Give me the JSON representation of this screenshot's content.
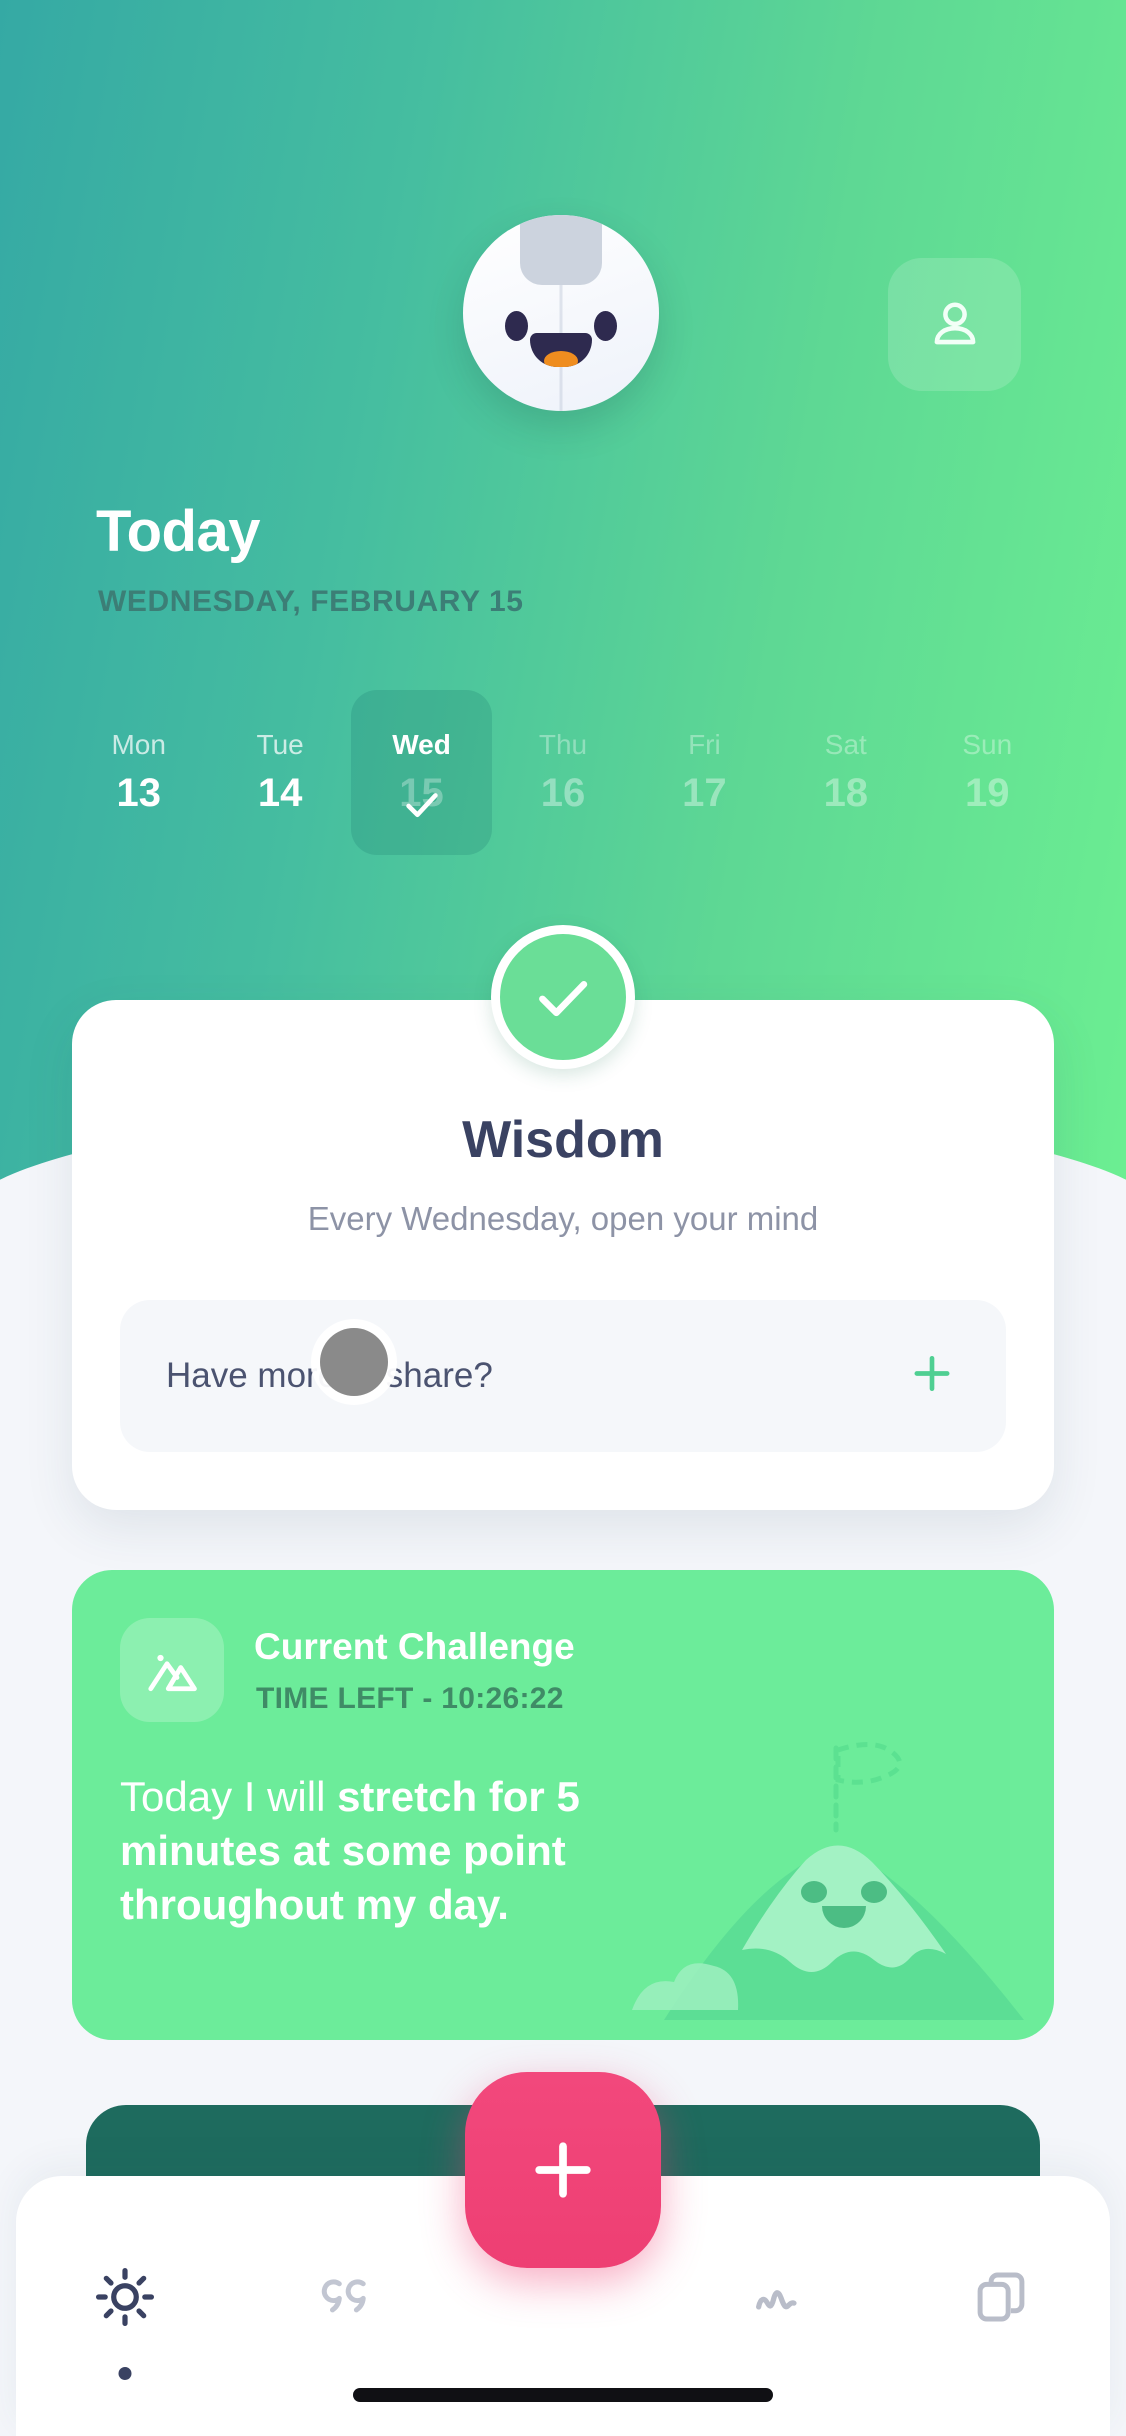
{
  "header": {
    "mascot_name": "penguin-mascot",
    "profile_icon": "person-icon",
    "title": "Today",
    "date_line": "WEDNESDAY, FEBRUARY 15"
  },
  "week": {
    "days": [
      {
        "dow": "Mon",
        "num": "13",
        "state": "past"
      },
      {
        "dow": "Tue",
        "num": "14",
        "state": "past"
      },
      {
        "dow": "Wed",
        "num": "15",
        "state": "today"
      },
      {
        "dow": "Thu",
        "num": "16",
        "state": "future"
      },
      {
        "dow": "Fri",
        "num": "17",
        "state": "future"
      },
      {
        "dow": "Sat",
        "num": "18",
        "state": "future"
      },
      {
        "dow": "Sun",
        "num": "19",
        "state": "future"
      }
    ]
  },
  "wisdom": {
    "badge_icon": "check-icon",
    "title": "Wisdom",
    "subtitle": "Every Wednesday, open your mind",
    "share_placeholder": "Have more to share?",
    "add_icon": "plus-icon"
  },
  "challenge": {
    "icon": "mountain-image-icon",
    "title": "Current Challenge",
    "time_left": "TIME LEFT - 10:26:22",
    "body_prefix": "Today I will ",
    "body_bold": "stretch for 5 minutes at some point throughout my day.",
    "art": "smiling-mountain-with-flag"
  },
  "bottom_nav": {
    "items": [
      {
        "icon": "sun-icon",
        "active": true
      },
      {
        "icon": "quote-icon",
        "active": false
      },
      {
        "icon": "wave-icon",
        "active": false
      },
      {
        "icon": "cards-icon",
        "active": false
      }
    ],
    "fab_icon": "plus-icon"
  },
  "colors": {
    "hero_start": "#35a9a4",
    "hero_end": "#6cef92",
    "accent_green": "#6ade97",
    "challenge_green": "#6cec9a",
    "fab_pink": "#ee3f73",
    "peek_teal": "#1e6b5e",
    "text_dark": "#3a4262",
    "text_muted": "#8d93a6",
    "page_bg": "#f4f6fa"
  }
}
